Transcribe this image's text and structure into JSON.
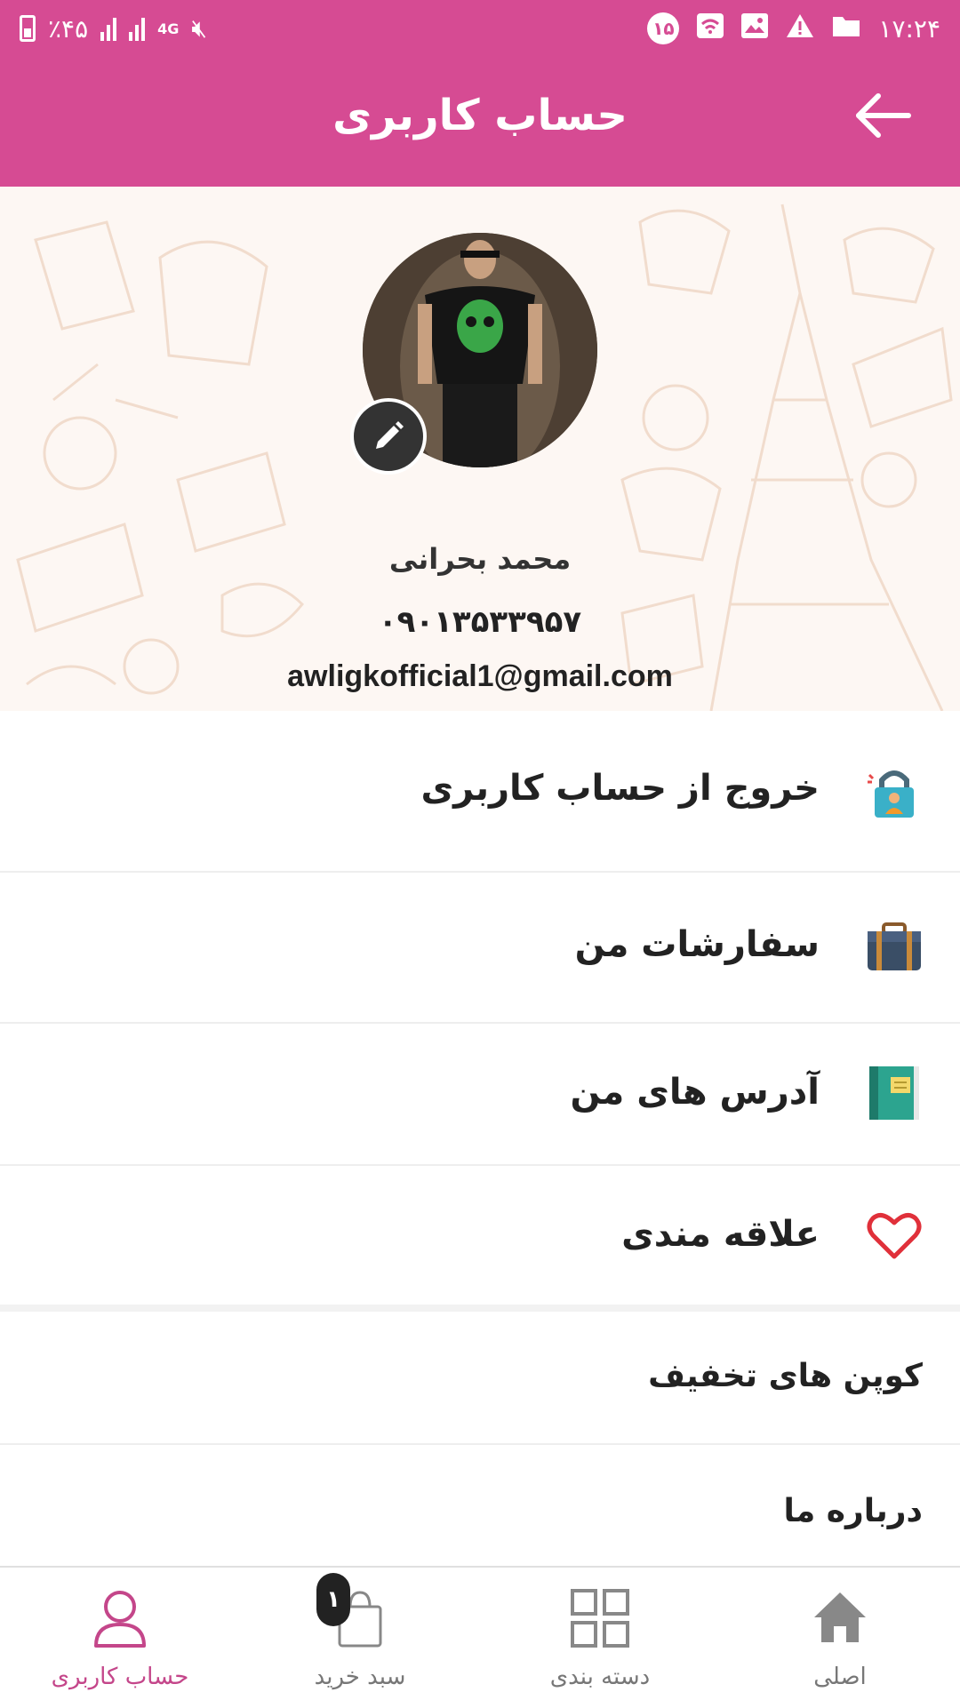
{
  "status_bar": {
    "battery_text": "٪۴۵",
    "network_label": "4G",
    "notification_count": "۱۵",
    "time": "۱۷:۲۴"
  },
  "app_bar": {
    "title": "حساب کاربری",
    "back_icon": "arrow-right-icon"
  },
  "profile": {
    "name": "محمد بحرانی",
    "phone": "۰۹۰۱۳۵۳۳۹۵۷",
    "email": "awligkofficial1@gmail.com",
    "edit_icon": "pencil-icon"
  },
  "menu": {
    "logout": {
      "label": "خروج از حساب کاربری",
      "icon": "lock-user-icon"
    },
    "orders": {
      "label": "سفارشات من",
      "icon": "briefcase-icon"
    },
    "addresses": {
      "label": "آدرس های من",
      "icon": "address-book-icon"
    },
    "favorites": {
      "label": "علاقه مندی",
      "icon": "heart-icon"
    },
    "coupons": {
      "label": "کوپن های تخفیف"
    },
    "about": {
      "label": "درباره ما"
    }
  },
  "bottom_nav": {
    "account": {
      "label": "حساب کاربری",
      "icon": "user-icon"
    },
    "cart": {
      "label": "سبد خرید",
      "icon": "shopping-bag-icon",
      "badge": "۱"
    },
    "categories": {
      "label": "دسته بندی",
      "icon": "grid-icon"
    },
    "home": {
      "label": "اصلی",
      "icon": "home-icon"
    }
  },
  "colors": {
    "primary": "#d64b93",
    "active_nav": "#c4468a",
    "heart": "#e0303a"
  }
}
